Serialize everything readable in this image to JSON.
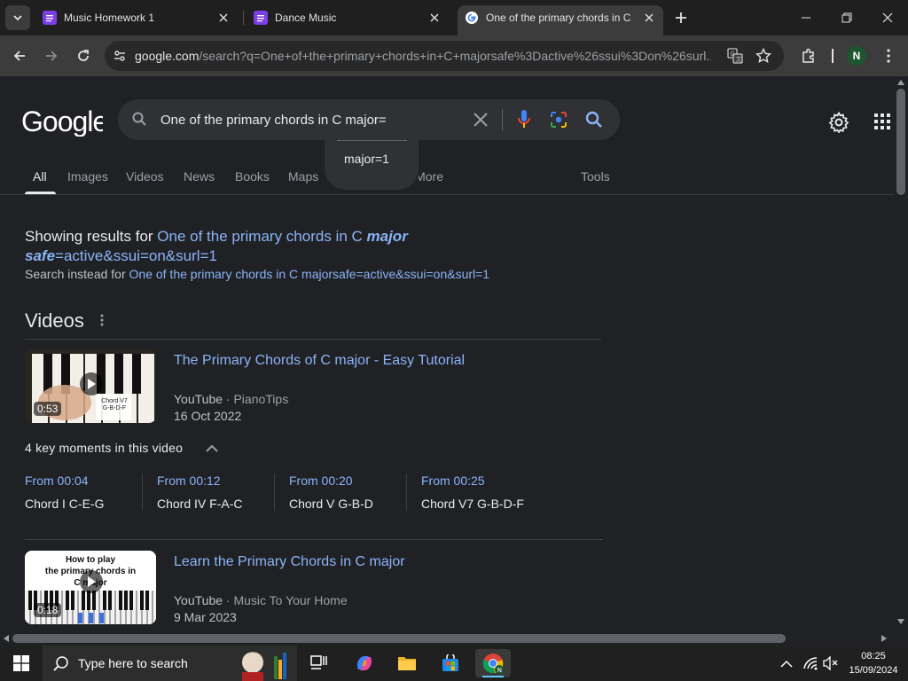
{
  "tabs": [
    {
      "title": "Music Homework 1",
      "favicon_color": "#7b3fe4"
    },
    {
      "title": "Dance Music",
      "favicon_color": "#7b3fe4"
    },
    {
      "title": "One of the primary chords in C",
      "favicon_color": "#ffffff"
    }
  ],
  "address_bar": {
    "host": "google.com",
    "path": "/search?q=One+of+the+primary+chords+in+C+majorsafe%3Dactive%26ssui%3Don%26surl..."
  },
  "profile_initial": "N",
  "search": {
    "query": "One of the primary chords in C major=",
    "suggestion": "major=1"
  },
  "nav_tabs": [
    {
      "label": "All",
      "active": true
    },
    {
      "label": "Images"
    },
    {
      "label": "Videos"
    },
    {
      "label": "News"
    },
    {
      "label": "Books"
    },
    {
      "label": "Maps"
    },
    {
      "label": "More"
    }
  ],
  "tools_label": "Tools",
  "correction": {
    "prefix": "Showing results for ",
    "corrected_1": "One of the primary chords in C ",
    "corrected_bold_1": "major",
    "corrected_bold_2": "safe",
    "corrected_2": "=active&ssui=on&surl=1",
    "instead_prefix": "Search instead for ",
    "instead_link": "One of the primary chords in C majorsafe=active&ssui=on&surl=1"
  },
  "videos_heading": "Videos",
  "videos": [
    {
      "title": "The Primary Chords of C major - Easy Tutorial",
      "source": "YouTube",
      "channel": "PianoTips",
      "date": "16 Oct 2022",
      "duration": "0:53",
      "thumb_text_1": "Chord V7",
      "thumb_text_2": "G-B-D-F"
    },
    {
      "title": "Learn the Primary Chords in C major",
      "source": "YouTube",
      "channel": "Music To Your Home",
      "date": "9 Mar 2023",
      "duration": "0:18",
      "thumb_text_1": "How to play",
      "thumb_text_2": "the primary chords in",
      "thumb_text_3": "C major"
    }
  ],
  "key_moments": {
    "heading": "4 key moments in this video",
    "items": [
      {
        "time": "From 00:04",
        "label": "Chord I C-E-G"
      },
      {
        "time": "From 00:12",
        "label": "Chord IV F-A-C"
      },
      {
        "time": "From 00:20",
        "label": "Chord V G-B-D"
      },
      {
        "time": "From 00:25",
        "label": "Chord V7 G-B-D-F"
      }
    ]
  },
  "taskbar": {
    "search_placeholder": "Type here to search",
    "time": "08:25",
    "date": "15/09/2024"
  }
}
